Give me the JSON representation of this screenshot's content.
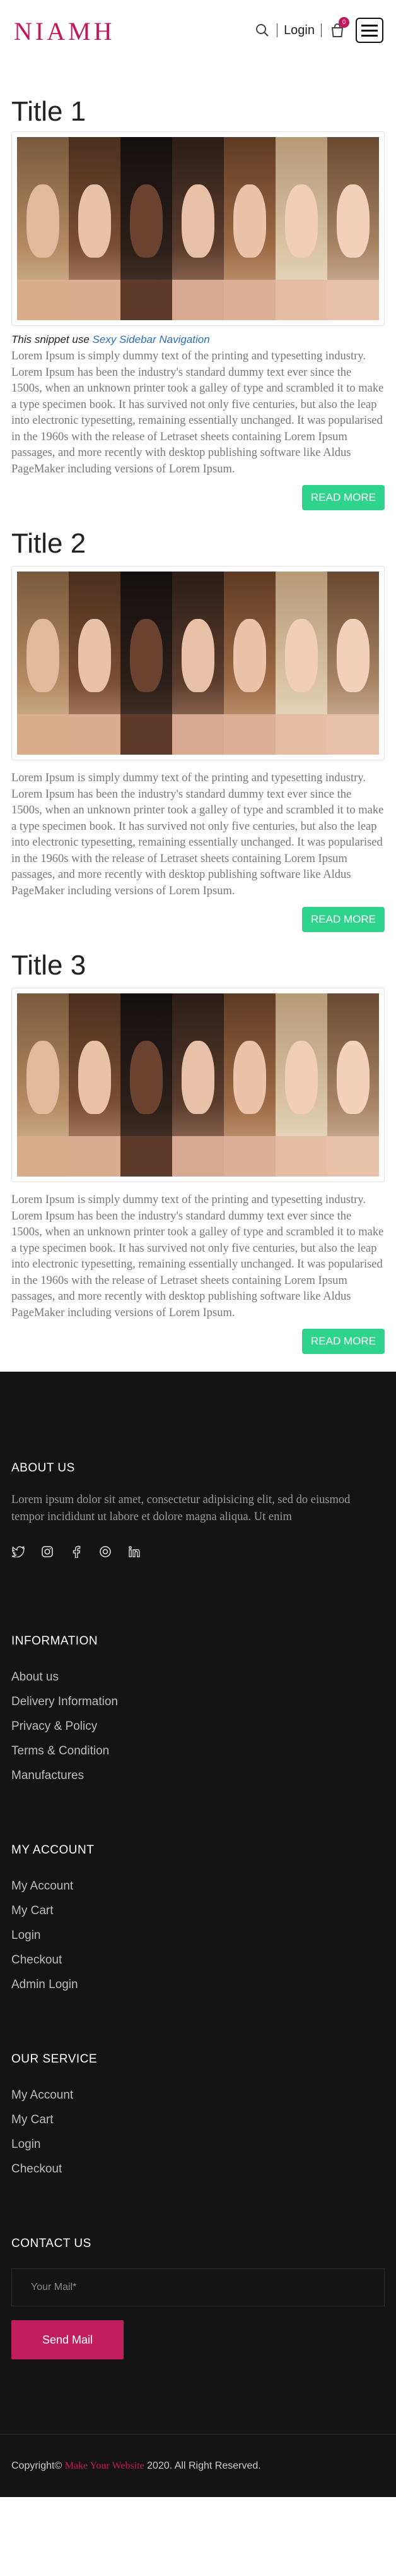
{
  "header": {
    "logo": "NIAMH",
    "login_label": "Login",
    "cart_count": "0",
    "icons": {
      "search": "search-icon",
      "cart": "shopping-bag-icon",
      "menu": "hamburger-icon"
    }
  },
  "posts": [
    {
      "title": "Title 1",
      "snippet_prefix": "This snippet use",
      "snippet_link": "Sexy Sidebar Navigation",
      "body": "Lorem Ipsum is simply dummy text of the printing and typesetting industry. Lorem Ipsum has been the industry's standard dummy text ever since the 1500s, when an unknown printer took a galley of type and scrambled it to make a type specimen book. It has survived not only five centuries, but also the leap into electronic typesetting, remaining essentially unchanged. It was popularised in the 1960s with the release of Letraset sheets containing Lorem Ipsum passages, and more recently with desktop publishing software like Aldus PageMaker including versions of Lorem Ipsum.",
      "button": "READ MORE"
    },
    {
      "title": "Title 2",
      "body": "Lorem Ipsum is simply dummy text of the printing and typesetting industry. Lorem Ipsum has been the industry's standard dummy text ever since the 1500s, when an unknown printer took a galley of type and scrambled it to make a type specimen book. It has survived not only five centuries, but also the leap into electronic typesetting, remaining essentially unchanged. It was popularised in the 1960s with the release of Letraset sheets containing Lorem Ipsum passages, and more recently with desktop publishing software like Aldus PageMaker including versions of Lorem Ipsum.",
      "button": "READ MORE"
    },
    {
      "title": "Title 3",
      "body": "Lorem Ipsum is simply dummy text of the printing and typesetting industry. Lorem Ipsum has been the industry's standard dummy text ever since the 1500s, when an unknown printer took a galley of type and scrambled it to make a type specimen book. It has survived not only five centuries, but also the leap into electronic typesetting, remaining essentially unchanged. It was popularised in the 1960s with the release of Letraset sheets containing Lorem Ipsum passages, and more recently with desktop publishing software like Aldus PageMaker including versions of Lorem Ipsum.",
      "button": "READ MORE"
    }
  ],
  "footer": {
    "about": {
      "heading": "ABOUT US",
      "text": "Lorem ipsum dolor sit amet, consectetur adipisicing elit, sed do eiusmod tempor incididunt ut labore et dolore magna aliqua. Ut enim",
      "socials": [
        "twitter-icon",
        "instagram-icon",
        "facebook-icon",
        "dribbble-icon",
        "linkedin-icon"
      ]
    },
    "information": {
      "heading": "INFORMATION",
      "links": [
        "About us",
        "Delivery Information",
        "Privacy & Policy",
        "Terms & Condition",
        "Manufactures"
      ]
    },
    "account": {
      "heading": "MY ACCOUNT",
      "links": [
        "My Account",
        "My Cart",
        "Login",
        "Checkout",
        "Admin Login"
      ]
    },
    "service": {
      "heading": "OUR SERVICE",
      "links": [
        "My Account",
        "My Cart",
        "Login",
        "Checkout"
      ]
    },
    "contact": {
      "heading": "CONTACT US",
      "placeholder": "Your Mail*",
      "button": "Send Mail"
    },
    "copyright": {
      "prefix": "Copyright©",
      "link": "Make Your Website",
      "suffix": "2020. All Right Reserved."
    }
  },
  "colors": {
    "brand": "#c2185b",
    "read_more": "#2fd48c",
    "footer_bg": "#141414",
    "send_button": "#c21e5e"
  }
}
